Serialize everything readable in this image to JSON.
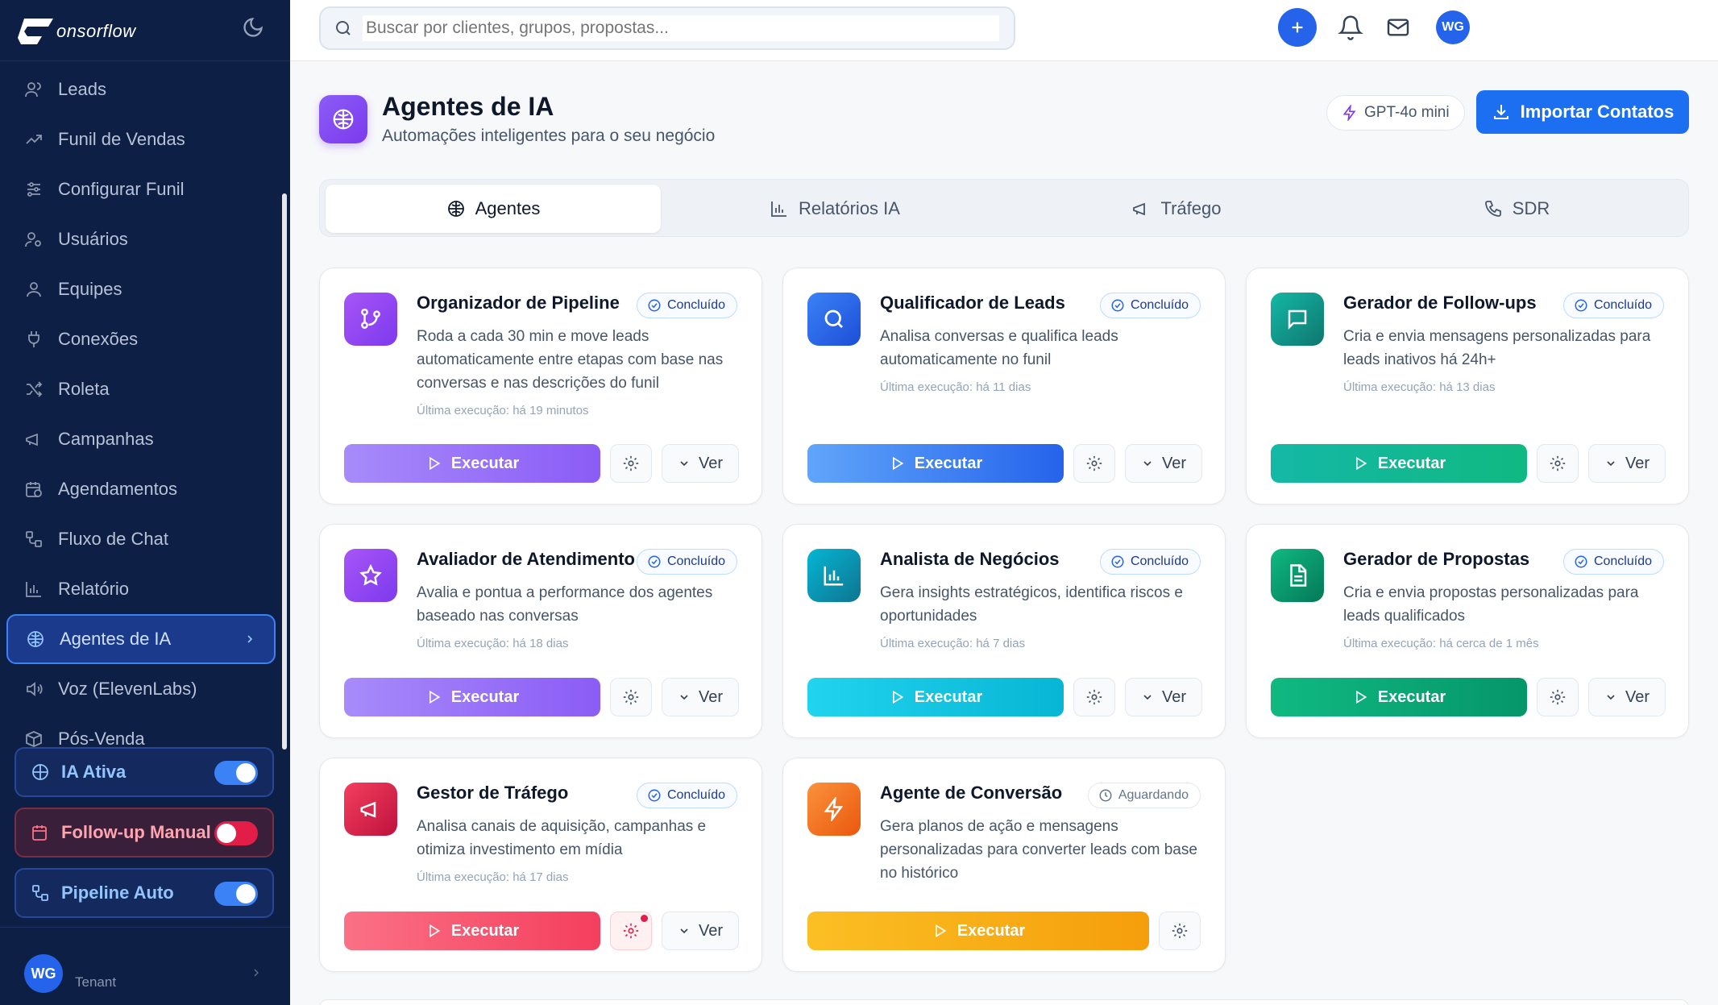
{
  "app": {
    "brand": "onsorflow"
  },
  "sidebar": {
    "items": [
      {
        "label": "Leads",
        "icon": "users-icon"
      },
      {
        "label": "Funil de Vendas",
        "icon": "trending-up-icon"
      },
      {
        "label": "Configurar Funil",
        "icon": "sliders-icon"
      },
      {
        "label": "Usuários",
        "icon": "user-cog-icon"
      },
      {
        "label": "Equipes",
        "icon": "team-icon"
      },
      {
        "label": "Conexões",
        "icon": "plug-icon"
      },
      {
        "label": "Roleta",
        "icon": "shuffle-icon"
      },
      {
        "label": "Campanhas",
        "icon": "megaphone-icon"
      },
      {
        "label": "Agendamentos",
        "icon": "calendar-clock-icon"
      },
      {
        "label": "Fluxo de Chat",
        "icon": "workflow-icon"
      },
      {
        "label": "Relatório",
        "icon": "bar-chart-icon"
      },
      {
        "label": "Agentes de IA",
        "icon": "brain-icon",
        "active": true
      },
      {
        "label": "Voz (ElevenLabs)",
        "icon": "speaker-icon"
      },
      {
        "label": "Pós-Venda",
        "icon": "package-icon"
      }
    ],
    "toggles": [
      {
        "label": "IA Ativa",
        "state": "on",
        "icon": "brain-icon"
      },
      {
        "label": "Follow-up Manual",
        "state": "off",
        "icon": "calendar-clock-icon"
      },
      {
        "label": "Pipeline Auto",
        "state": "on",
        "icon": "workflow-icon"
      }
    ],
    "user": {
      "initials": "WG",
      "tenant": "Tenant"
    }
  },
  "topbar": {
    "search_placeholder": "Buscar por clientes, grupos, propostas...",
    "avatar_initials": "WG"
  },
  "header": {
    "title": "Agentes de IA",
    "subtitle": "Automações inteligentes para o seu negócio",
    "model": "GPT-4o mini",
    "import_label": "Importar Contatos"
  },
  "tabs": [
    {
      "label": "Agentes",
      "icon": "brain-icon",
      "active": true
    },
    {
      "label": "Relatórios IA",
      "icon": "bar-chart-icon"
    },
    {
      "label": "Tráfego",
      "icon": "megaphone-icon"
    },
    {
      "label": "SDR",
      "icon": "phone-icon"
    }
  ],
  "agents": [
    {
      "title": "Organizador de Pipeline",
      "status": "Concluído",
      "description": "Roda a cada 30 min e move leads automaticamente entre etapas com base nas conversas e nas descrições do funil",
      "last_run": "Última execução: há 19 minutos",
      "icon": "git-branch-icon",
      "color": "purple",
      "execute_label": "Executar",
      "view_label": "Ver"
    },
    {
      "title": "Qualificador de Leads",
      "status": "Concluído",
      "description": "Analisa conversas e qualifica leads automaticamente no funil",
      "last_run": "Última execução: há 11 dias",
      "icon": "search-icon",
      "color": "blue",
      "execute_label": "Executar",
      "view_label": "Ver"
    },
    {
      "title": "Gerador de Follow-ups",
      "status": "Concluído",
      "description": "Cria e envia mensagens personalizadas para leads inativos há 24h+",
      "last_run": "Última execução: há 13 dias",
      "icon": "message-square-icon",
      "color": "teal",
      "execute_label": "Executar",
      "view_label": "Ver"
    },
    {
      "title": "Avaliador de Atendimento",
      "status": "Concluído",
      "description": "Avalia e pontua a performance dos agentes baseado nas conversas",
      "last_run": "Última execução: há 18 dias",
      "icon": "star-icon",
      "color": "purple",
      "execute_label": "Executar",
      "view_label": "Ver"
    },
    {
      "title": "Analista de Negócios",
      "status": "Concluído",
      "description": "Gera insights estratégicos, identifica riscos e oportunidades",
      "last_run": "Última execução: há 7 dias",
      "icon": "bar-chart-icon",
      "color": "cyan",
      "execute_label": "Executar",
      "view_label": "Ver"
    },
    {
      "title": "Gerador de Propostas",
      "status": "Concluído",
      "description": "Cria e envia propostas personalizadas para leads qualificados",
      "last_run": "Última execução: há cerca de 1 mês",
      "icon": "file-text-icon",
      "color": "green",
      "execute_label": "Executar",
      "view_label": "Ver"
    },
    {
      "title": "Gestor de Tráfego",
      "status": "Concluído",
      "description": "Analisa canais de aquisição, campanhas e otimiza investimento em mídia",
      "last_run": "Última execução: há 17 dias",
      "icon": "megaphone-icon",
      "color": "red",
      "execute_label": "Executar",
      "view_label": "Ver"
    },
    {
      "title": "Agente de Conversão",
      "status": "Aguardando",
      "description": "Gera planos de ação e mensagens personalizadas para converter leads com base no histórico",
      "last_run": "",
      "icon": "zap-icon",
      "color": "orange",
      "execute_label": "Executar",
      "view_label": ""
    }
  ],
  "colors": {
    "accent": "#2563eb",
    "sidebar_bg": "#0e1f45",
    "active_nav": "#1b3a8c"
  }
}
